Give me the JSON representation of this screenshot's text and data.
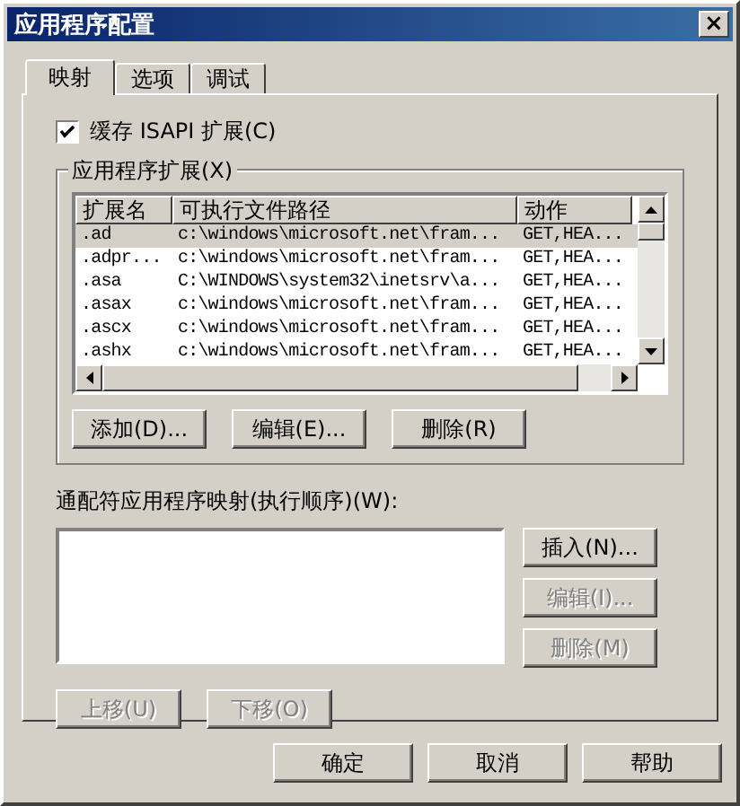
{
  "window": {
    "title": "应用程序配置",
    "close": "×"
  },
  "tabs": [
    {
      "label": "映射",
      "selected": true
    },
    {
      "label": "选项",
      "selected": false
    },
    {
      "label": "调试",
      "selected": false
    }
  ],
  "cache_checkbox": {
    "label": "缓存 ISAPI 扩展(C)",
    "checked": true
  },
  "extensions": {
    "title": "应用程序扩展(X)",
    "columns": [
      "扩展名",
      "可执行文件路径",
      "动作"
    ],
    "rows": [
      {
        "cells": [
          ".ad",
          "c:\\windows\\microsoft.net\\fram...",
          "GET,HEA..."
        ],
        "selected": true
      },
      {
        "cells": [
          ".adpr...",
          "c:\\windows\\microsoft.net\\fram...",
          "GET,HEA..."
        ],
        "selected": false
      },
      {
        "cells": [
          ".asa",
          "C:\\WINDOWS\\system32\\inetsrv\\a...",
          "GET,HEA..."
        ],
        "selected": false
      },
      {
        "cells": [
          ".asax",
          "c:\\windows\\microsoft.net\\fram...",
          "GET,HEA..."
        ],
        "selected": false
      },
      {
        "cells": [
          ".ascx",
          "c:\\windows\\microsoft.net\\fram...",
          "GET,HEA..."
        ],
        "selected": false
      },
      {
        "cells": [
          ".ashx",
          "c:\\windows\\microsoft.net\\fram...",
          "GET,HEA..."
        ],
        "selected": false
      }
    ],
    "buttons": [
      {
        "label": "添加(D)...",
        "disabled": false
      },
      {
        "label": "编辑(E)...",
        "disabled": false
      },
      {
        "label": "删除(R)",
        "disabled": false
      }
    ]
  },
  "wildcard": {
    "label": "通配符应用程序映射(执行顺序)(W):",
    "side_buttons": [
      {
        "label": "插入(N)...",
        "disabled": false
      },
      {
        "label": "编辑(I)...",
        "disabled": true
      },
      {
        "label": "删除(M)",
        "disabled": true
      }
    ],
    "move_buttons": [
      {
        "label": "上移(U)",
        "disabled": true
      },
      {
        "label": "下移(O)",
        "disabled": true
      }
    ]
  },
  "dialog_buttons": [
    {
      "label": "确定",
      "disabled": false
    },
    {
      "label": "取消",
      "disabled": false
    },
    {
      "label": "帮助",
      "disabled": false
    }
  ]
}
